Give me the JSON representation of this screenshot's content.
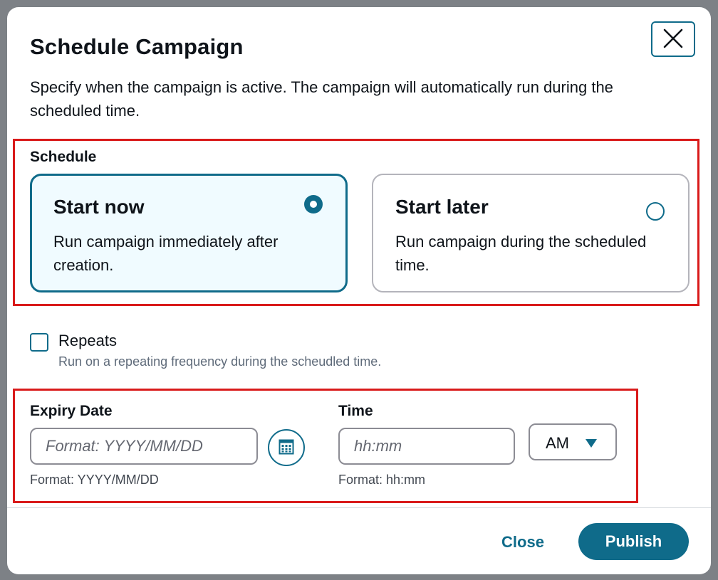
{
  "modal": {
    "title": "Schedule Campaign",
    "description": "Specify when the campaign is active. The campaign will automatically run during the scheduled time."
  },
  "schedule": {
    "label": "Schedule",
    "options": [
      {
        "title": "Start now",
        "description": "Run campaign immediately after creation.",
        "selected": true
      },
      {
        "title": "Start later",
        "description": "Run campaign during the scheduled time.",
        "selected": false
      }
    ]
  },
  "repeats": {
    "label": "Repeats",
    "help": "Run on a repeating frequency during the scheudled time.",
    "checked": false
  },
  "expiry": {
    "label": "Expiry Date",
    "placeholder": "Format: YYYY/MM/DD",
    "help": "Format: YYYY/MM/DD",
    "value": ""
  },
  "time": {
    "label": "Time",
    "placeholder": "hh:mm",
    "help": "Format: hh:mm",
    "value": "",
    "period": "AM"
  },
  "footer": {
    "close_label": "Close",
    "publish_label": "Publish"
  },
  "colors": {
    "accent": "#0f6b8a",
    "highlight_border": "#d91a1a",
    "selected_card_bg": "#f0fbff"
  },
  "icons": {
    "dismiss": "close-icon",
    "calendar": "calendar-icon",
    "dropdown": "caret-down-icon"
  }
}
